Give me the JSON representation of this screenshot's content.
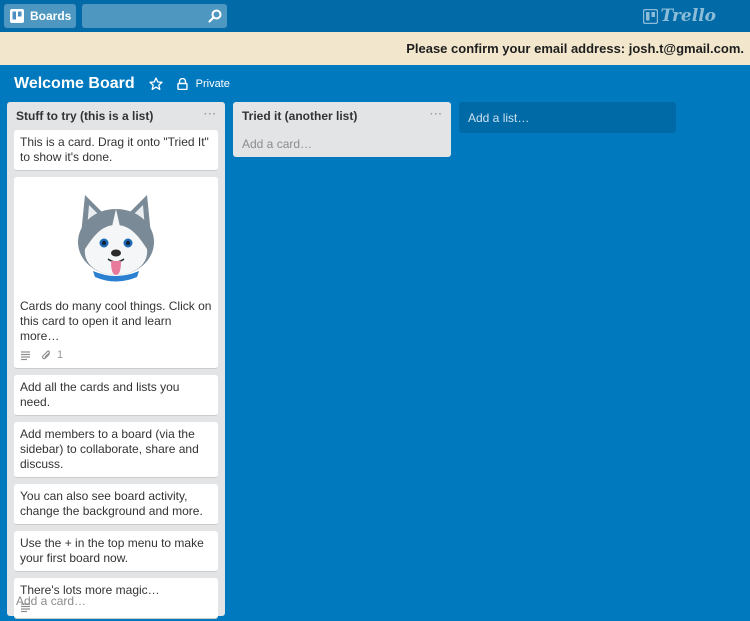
{
  "header": {
    "boards_label": "Boards",
    "search_placeholder": "",
    "logo_text": "Trello"
  },
  "banner": {
    "text": "Please confirm your email address: josh.t@gmail.com."
  },
  "board": {
    "title": "Welcome Board",
    "visibility": "Private"
  },
  "lists": [
    {
      "title": "Stuff to try (this is a list)",
      "add_card": "Add a card…",
      "cards": [
        {
          "text": "This is a card. Drag it onto \"Tried It\" to show it's done."
        },
        {
          "text": "Cards do many cool things. Click on this card to open it and learn more…",
          "cover": "husky-mascot",
          "badges": {
            "description": true,
            "checklist_count": "1"
          }
        },
        {
          "text": "Add all the cards and lists you need."
        },
        {
          "text": "Add members to a board (via the sidebar) to collaborate, share and discuss."
        },
        {
          "text": "You can also see board activity, change the background and more."
        },
        {
          "text": "Use the + in the top menu to make your first board now."
        },
        {
          "text": "There's lots more magic…",
          "badges": {
            "description": true
          }
        }
      ]
    },
    {
      "title": "Tried it (another list)",
      "add_card": "Add a card…",
      "cards": []
    }
  ],
  "add_list": "Add a list…",
  "menu_dots": "···",
  "colors": {
    "board_bg": "#0079bf",
    "header_bg": "#026aa7",
    "banner_bg": "#f2e7cd",
    "list_bg": "#e2e4e6"
  }
}
